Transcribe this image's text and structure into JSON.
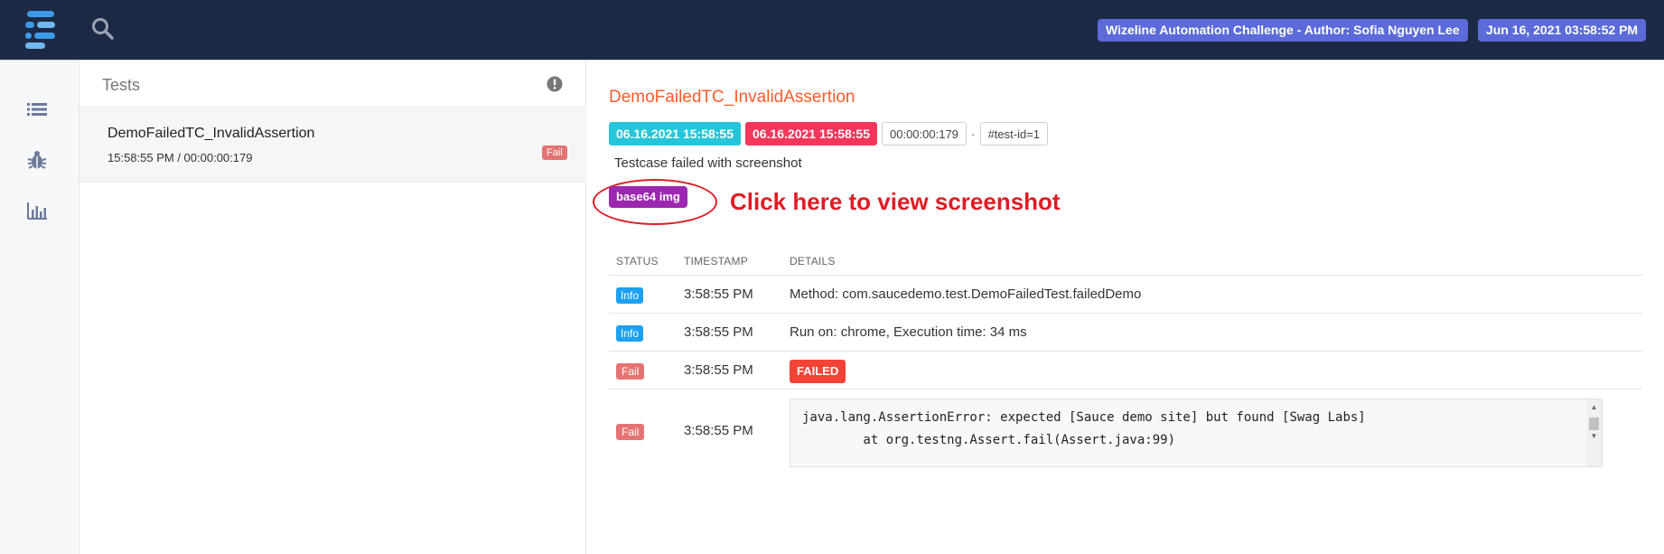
{
  "navbar": {
    "author_badge": "Wizeline Automation Challenge - Author: Sofia Nguyen Lee",
    "date_badge": "Jun 16, 2021 03:58:52 PM"
  },
  "sidebar": {
    "items": [
      {
        "icon": "list-icon"
      },
      {
        "icon": "bug-icon"
      },
      {
        "icon": "bar-chart-icon"
      }
    ]
  },
  "tests_panel": {
    "title": "Tests",
    "items": [
      {
        "name": "DemoFailedTC_InvalidAssertion",
        "meta": "15:58:55 PM / 00:00:00:179",
        "status": "Fail"
      }
    ]
  },
  "detail": {
    "title": "DemoFailedTC_InvalidAssertion",
    "start_time": "06.16.2021 15:58:55",
    "end_time": "06.16.2021 15:58:55",
    "duration": "00:00:00:179",
    "separator": "·",
    "test_id": "#test-id=1",
    "description": "Testcase failed with screenshot",
    "image_badge": "base64 img",
    "annotation": "Click here to view screenshot"
  },
  "log": {
    "headers": {
      "status": "STATUS",
      "timestamp": "TIMESTAMP",
      "details": "DETAILS"
    },
    "rows": [
      {
        "status": "Info",
        "time": "3:58:55 PM",
        "details": "Method: com.saucedemo.test.DemoFailedTest.failedDemo"
      },
      {
        "status": "Info",
        "time": "3:58:55 PM",
        "details": "Run on: chrome, Execution time: 34 ms"
      },
      {
        "status": "Fail",
        "time": "3:58:55 PM",
        "details": "FAILED"
      },
      {
        "status": "Fail",
        "time": "3:58:55 PM",
        "code_lines": [
          "java.lang.AssertionError: expected [Sauce demo site] but found [Swag Labs]",
          "        at org.testng.Assert.fail(Assert.java:99)"
        ]
      }
    ]
  },
  "colors": {
    "navbar_bg": "#1c2a46",
    "badge_indigo": "#5c6bd9",
    "title_orange": "#fa5b2a",
    "start_teal": "#26c6da",
    "end_pink": "#f5365c",
    "img_purple": "#9c27b0",
    "info_blue": "#1da1f2",
    "fail_red": "#e57373",
    "annotation_red": "#e01b24"
  }
}
